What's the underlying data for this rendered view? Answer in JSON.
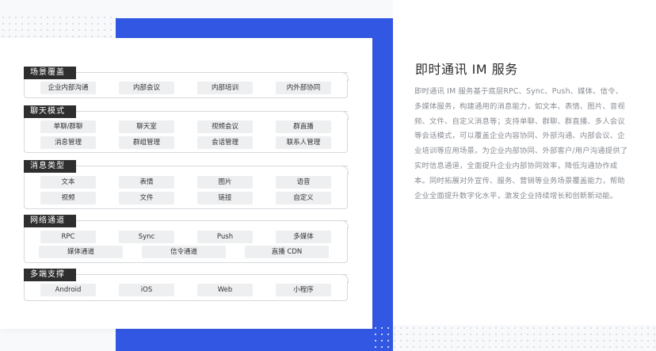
{
  "sections": [
    {
      "title": "场景覆盖",
      "rows": [
        [
          "企业内部沟通",
          "内部会议",
          "内部培训",
          "内外部协同"
        ]
      ]
    },
    {
      "title": "聊天模式",
      "rows": [
        [
          "单聊/群聊",
          "聊天室",
          "视频会议",
          "群直播"
        ],
        [
          "消息管理",
          "群组管理",
          "会话管理",
          "联系人管理"
        ]
      ]
    },
    {
      "title": "消息类型",
      "rows": [
        [
          "文本",
          "表情",
          "图片",
          "语音"
        ],
        [
          "视频",
          "文件",
          "链接",
          "自定义"
        ]
      ]
    },
    {
      "title": "网络通道",
      "rows": [
        [
          "RPC",
          "Sync",
          "Push",
          "多媒体"
        ],
        [
          "媒体通道",
          "信令通道",
          "直播 CDN"
        ]
      ]
    },
    {
      "title": "多端支撑",
      "rows": [
        [
          "Android",
          "iOS",
          "Web",
          "小程序"
        ]
      ]
    }
  ],
  "info": {
    "title": "即时通讯 IM 服务",
    "description": "即时通讯 IM 服务基于底层RPC、Sync、Push、媒体、信令、多媒体服务，构建通用的消息能力，如文本、表情、图片、音视频、文件、自定义消息等；支持单聊、群聊、群直播、多人会议等会话模式，可以覆盖企业内容协同、外部沟通、内部会议、企业培训等应用场景。为企业内部协同、外部客户/用户沟通提供了实时信息通道，全面提升企业内部协同效率，降低沟通协作成本。同时拓展对外宣传、服务、营销等业务场景覆盖能力，帮助企业全面提升数字化水平，激发企业持续增长和创新新动能。"
  },
  "colors": {
    "accent_blue": "#3257e3",
    "tag_dark": "#2e2e2e",
    "chip_bg": "#eeeff1"
  }
}
